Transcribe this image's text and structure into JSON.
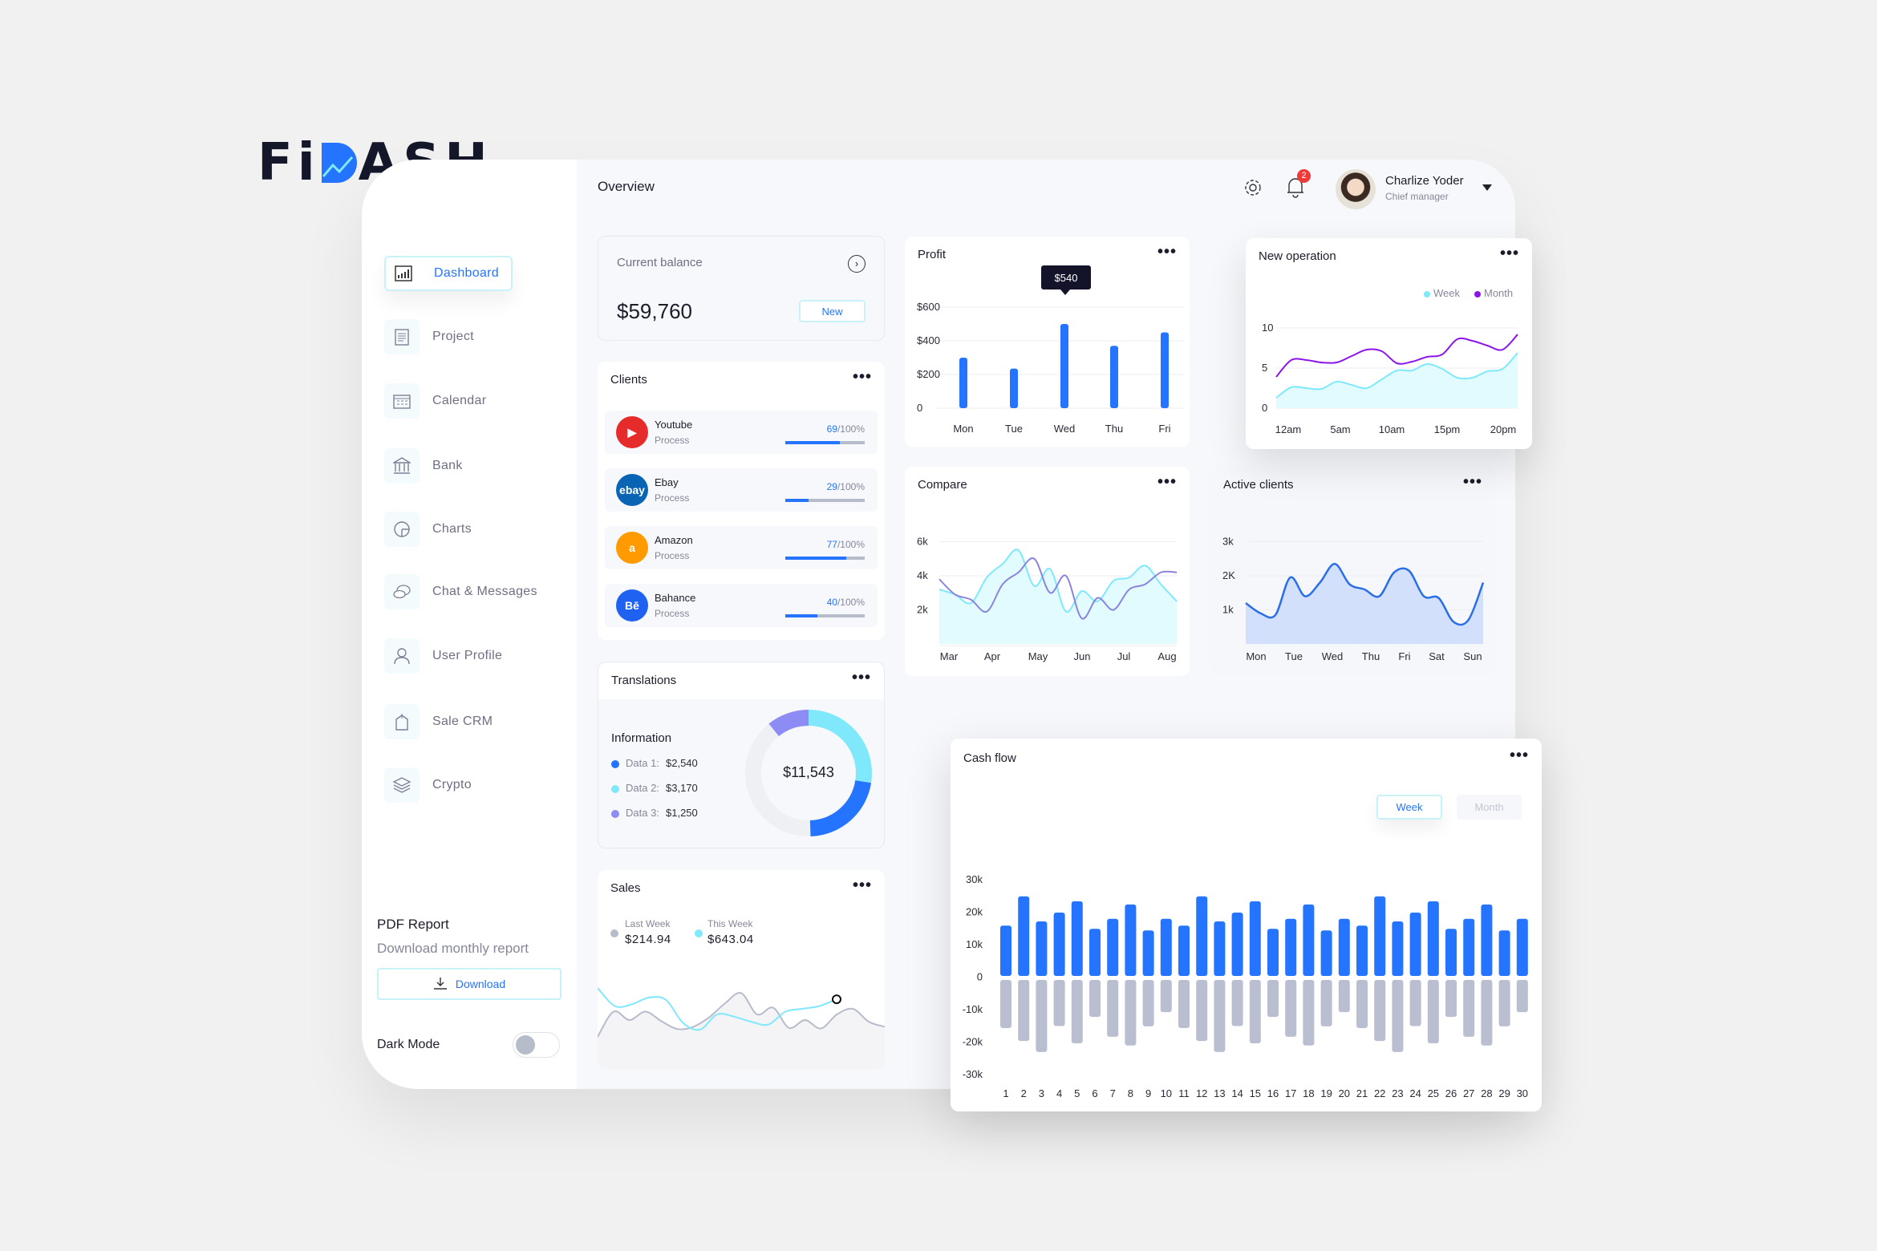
{
  "brand": {
    "logo_text": "FiDASH",
    "accent": "#2474ff"
  },
  "header": {
    "title": "Overview",
    "notifications": "2",
    "user_name": "Charlize Yoder",
    "user_role": "Chief manager"
  },
  "sidebar": {
    "items": [
      {
        "label": "Dashboard",
        "icon": "bar-chart-icon",
        "active": true
      },
      {
        "label": "Project",
        "icon": "clipboard-icon"
      },
      {
        "label": "Calendar",
        "icon": "calendar-icon"
      },
      {
        "label": "Bank",
        "icon": "bank-icon"
      },
      {
        "label": "Charts",
        "icon": "pie-chart-icon"
      },
      {
        "label": "Chat & Messages",
        "icon": "chat-icon"
      },
      {
        "label": "User Profile",
        "icon": "user-icon"
      },
      {
        "label": "Sale CRM",
        "icon": "tag-icon"
      },
      {
        "label": "Crypto",
        "icon": "layers-icon"
      }
    ],
    "pdf_title": "PDF Report",
    "pdf_sub": "Download monthly report",
    "download": "Download",
    "dark_mode": "Dark Mode",
    "dark_mode_on": false
  },
  "balance": {
    "label": "Current balance",
    "value": "$59,760",
    "new_label": "New"
  },
  "clients": {
    "title": "Clients",
    "items": [
      {
        "name": "Youtube",
        "status": "Process",
        "value": 69,
        "pct": "69",
        "total": "/100%",
        "color": "#e62b2b",
        "logo": "▶"
      },
      {
        "name": "Ebay",
        "status": "Process",
        "value": 29,
        "pct": "29",
        "total": "/100%",
        "color": "#0a64b4",
        "logo": "ebay"
      },
      {
        "name": "Amazon",
        "status": "Process",
        "value": 77,
        "pct": "77",
        "total": "/100%",
        "color": "#ff9a00",
        "logo": "a"
      },
      {
        "name": "Bahance",
        "status": "Process",
        "value": 40,
        "pct": "40",
        "total": "/100%",
        "color": "#1f62f2",
        "logo": "Bē"
      }
    ]
  },
  "translations": {
    "title": "Translations",
    "info": "Information",
    "total": "$11,543",
    "total_value": 11543,
    "items": [
      {
        "label": "Data 1:",
        "value": "$2,540",
        "amount": 2540,
        "color": "#2474ff"
      },
      {
        "label": "Data 2:",
        "value": "$3,170",
        "amount": 3170,
        "color": "#7fe9fb"
      },
      {
        "label": "Data 3:",
        "value": "$1,250",
        "amount": 1250,
        "color": "#8d8cf5"
      }
    ]
  },
  "sales": {
    "title": "Sales",
    "last_label": "Last Week",
    "last_value": "$214.94",
    "this_label": "This Week",
    "this_value": "$643.04",
    "last_color": "#b7bccb",
    "this_color": "#7fe9fb",
    "last_series": [
      1,
      5.5,
      4,
      5.5,
      3.8,
      2.4,
      2.8,
      4.5,
      7,
      8.8,
      5,
      6.2,
      2.6,
      4,
      2.5,
      5,
      6,
      3.7,
      2.8
    ],
    "this_series": [
      9.7,
      6.5,
      6.8,
      8,
      7.6,
      3.5,
      2.3,
      5,
      4.6,
      3.7,
      3.2,
      5.5,
      6,
      6.5,
      7.7
    ]
  },
  "chart_data": [
    {
      "id": "profit",
      "type": "bar",
      "title": "Profit",
      "categories": [
        "Mon",
        "Tue",
        "Wed",
        "Thu",
        "Fri"
      ],
      "values": [
        300,
        235,
        500,
        370,
        450
      ],
      "yticks": [
        "0",
        "$200",
        "$400",
        "$600"
      ],
      "ylim": [
        0,
        600
      ],
      "tooltip": "$540",
      "color": "#2474ff"
    },
    {
      "id": "new-operation",
      "type": "area",
      "title": "New operation",
      "categories": [
        "12am",
        "5am",
        "10am",
        "15pm",
        "20pm"
      ],
      "yticks": [
        "0",
        "5",
        "10"
      ],
      "ylim": [
        0,
        10
      ],
      "legend": "top-right",
      "series": [
        {
          "name": "Week",
          "color": "#7fe9fb",
          "values": [
            1.3,
            2.6,
            2.5,
            2.4,
            3.3,
            2.9,
            2.5,
            3.6,
            4.7,
            4.7,
            5.5,
            4.9,
            3.8,
            3.8,
            4.6,
            4.9,
            6.9
          ]
        },
        {
          "name": "Month",
          "color": "#8b14e8",
          "values": [
            3.9,
            6.0,
            6.0,
            5.7,
            5.7,
            6.5,
            7.3,
            7.1,
            5.6,
            5.8,
            6.4,
            6.7,
            8.6,
            8.4,
            7.8,
            7.3,
            9.2
          ]
        }
      ]
    },
    {
      "id": "compare",
      "type": "area",
      "title": "Compare",
      "categories": [
        "Mar",
        "Apr",
        "May",
        "Jun",
        "Jul",
        "Aug"
      ],
      "yticks": [
        "2k",
        "4k",
        "6k"
      ],
      "ylim": [
        0,
        6.8
      ],
      "series": [
        {
          "color": "#7fe9fb",
          "values": [
            3.2,
            2.9,
            2.4,
            3.9,
            4.7,
            5.5,
            3.4,
            4.4,
            1.9,
            3.1,
            2.5,
            3.7,
            3.9,
            4.6,
            3.5,
            2.5
          ]
        },
        {
          "color": "#8a84e0",
          "values": [
            3.8,
            2.9,
            2.6,
            1.9,
            3.5,
            4.2,
            5.0,
            3.0,
            4.0,
            1.5,
            2.7,
            2.0,
            3.2,
            3.5,
            4.2,
            4.2
          ]
        }
      ]
    },
    {
      "id": "active-clients",
      "type": "area",
      "title": "Active clients",
      "categories": [
        "Mon",
        "Tue",
        "Wed",
        "Thu",
        "Fri",
        "Sat",
        "Sun"
      ],
      "yticks": [
        "1k",
        "2K",
        "3k"
      ],
      "ylim": [
        0,
        3.4
      ],
      "series": [
        {
          "color": "#2a6ee8",
          "values": [
            1.2,
            0.9,
            0.85,
            1.95,
            1.4,
            1.8,
            2.35,
            1.75,
            1.6,
            1.4,
            2.1,
            2.15,
            1.4,
            1.35,
            0.65,
            0.7,
            1.8
          ]
        }
      ]
    },
    {
      "id": "cash-flow",
      "type": "bar",
      "title": "Cash flow",
      "toggle": [
        "Week",
        "Month"
      ],
      "selected": "Week",
      "categories": [
        "1",
        "2",
        "3",
        "4",
        "5",
        "6",
        "7",
        "8",
        "9",
        "10",
        "11",
        "12",
        "13",
        "14",
        "15",
        "16",
        "17",
        "18",
        "19",
        "20",
        "21",
        "22",
        "23",
        "24",
        "25",
        "26",
        "27",
        "28",
        "29",
        "30"
      ],
      "yticks": [
        "30k",
        "20k",
        "10k",
        "0",
        "-10k",
        "-20k",
        "-30k"
      ],
      "ylim": [
        -30,
        30
      ],
      "series": [
        {
          "color": "#2474ff",
          "values": [
            15.5,
            24.5,
            16.8,
            19.5,
            23,
            14.5,
            17.6,
            22,
            14,
            17.6,
            15.5,
            24.5,
            16.8,
            19.5,
            23,
            14.5,
            17.6,
            22,
            14,
            17.6,
            15.5,
            24.5,
            16.8,
            19.5,
            23,
            14.5,
            17.6,
            22,
            14,
            17.6
          ]
        },
        {
          "color": "#b9bed1",
          "values": [
            -14.8,
            -18.8,
            -22.2,
            -14.2,
            -19.5,
            -11.4,
            -17.5,
            -20.2,
            -14.3,
            -9.9,
            -14.8,
            -18.8,
            -22.2,
            -14.2,
            -19.5,
            -11.4,
            -17.5,
            -20.2,
            -14.3,
            -9.9,
            -14.8,
            -18.8,
            -22.2,
            -14.2,
            -19.5,
            -11.4,
            -17.5,
            -20.2,
            -14.3,
            -9.9
          ]
        }
      ]
    }
  ]
}
